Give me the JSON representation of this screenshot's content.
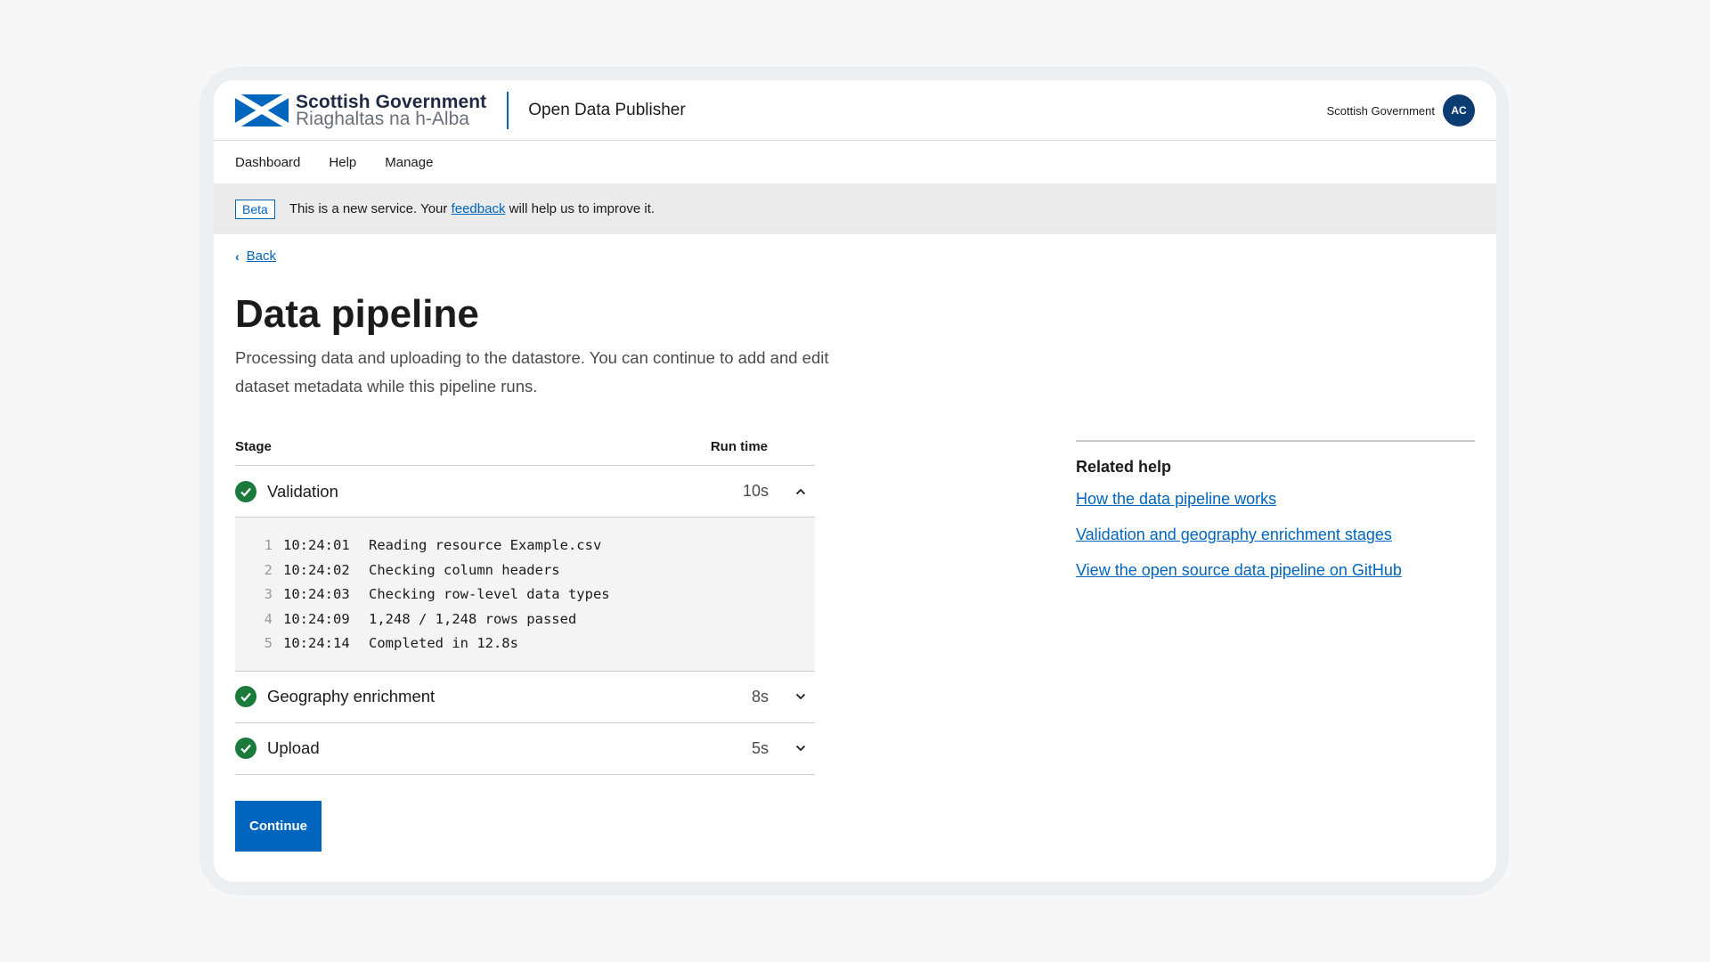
{
  "brand": {
    "name_en": "Scottish Government",
    "name_gd": "Riaghaltas na h-Alba",
    "service_name": "Open Data Publisher"
  },
  "header": {
    "organisation": "Scottish Government",
    "avatar_initials": "AC"
  },
  "nav": {
    "items": [
      {
        "label": "Dashboard"
      },
      {
        "label": "Help"
      },
      {
        "label": "Manage"
      }
    ]
  },
  "phase_banner": {
    "tag": "Beta",
    "text_before": "This is a new service. Your ",
    "link": "feedback",
    "text_after": " will help us to improve it."
  },
  "back": {
    "label": "Back"
  },
  "page": {
    "title": "Data pipeline",
    "lead": "Processing data and uploading to the datastore. You can continue to add and edit dataset metadata while this pipeline runs."
  },
  "pipeline": {
    "header_stage": "Stage",
    "header_runtime": "Run time",
    "stages": [
      {
        "name": "Validation",
        "time": "10s",
        "status": "complete",
        "expanded": true
      },
      {
        "name": "Geography enrichment",
        "time": "8s",
        "status": "complete",
        "expanded": false
      },
      {
        "name": "Upload",
        "time": "5s",
        "status": "complete",
        "expanded": false
      }
    ],
    "log": [
      {
        "n": "1",
        "time": "10:24:01",
        "message": "Reading resource Example.csv"
      },
      {
        "n": "2",
        "time": "10:24:02",
        "message": "Checking column headers"
      },
      {
        "n": "3",
        "time": "10:24:03",
        "message": "Checking row-level data types"
      },
      {
        "n": "4",
        "time": "10:24:09",
        "message": "1,248 / 1,248 rows passed"
      },
      {
        "n": "5",
        "time": "10:24:14",
        "message": "Completed in 12.8s"
      }
    ]
  },
  "actions": {
    "continue": "Continue"
  },
  "related_help": {
    "title": "Related help",
    "links": [
      {
        "label": "How the data pipeline works"
      },
      {
        "label": "Validation and geography enrichment stages"
      },
      {
        "label": "View the open source data pipeline on GitHub"
      }
    ]
  },
  "colors": {
    "accent": "#0065bd",
    "success": "#1a7a39",
    "avatar": "#0b3d73",
    "banner_bg": "#ebebeb"
  }
}
